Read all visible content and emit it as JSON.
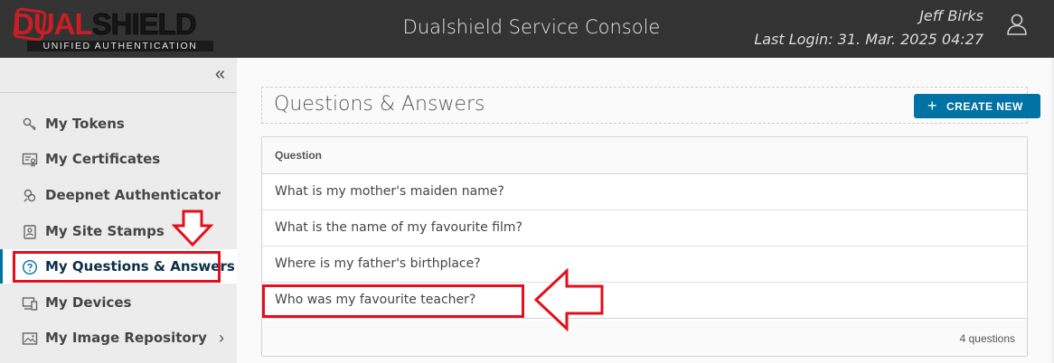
{
  "header": {
    "logo_text_red": "DUAL",
    "logo_text_dark": "SHIELD",
    "logo_tagline": "UNIFIED AUTHENTICATION",
    "app_title": "Dualshield Service Console",
    "user_name": "Jeff Birks",
    "last_login": "Last Login: 31. Mar. 2025 04:27",
    "user_icon": "user-icon"
  },
  "sidebar": {
    "collapse_icon": "double-chevron-left-icon",
    "collapse_glyph": "«",
    "items": [
      {
        "label": "My Tokens",
        "icon": "key-icon"
      },
      {
        "label": "My Certificates",
        "icon": "certificate-icon"
      },
      {
        "label": "Deepnet Authenticator",
        "icon": "authenticator-icon"
      },
      {
        "label": "My Site Stamps",
        "icon": "site-stamp-icon"
      },
      {
        "label": "My Questions & Answers",
        "icon": "question-circle-icon",
        "active": true
      },
      {
        "label": "My Devices",
        "icon": "devices-icon"
      },
      {
        "label": "My Image Repository",
        "icon": "image-icon",
        "expand_glyph": "›"
      }
    ]
  },
  "main": {
    "page_title": "Questions & Answers",
    "create_button": {
      "plus": "+",
      "label": "CREATE NEW"
    },
    "grid": {
      "column_header": "Question",
      "rows": [
        "What is my mother's maiden name?",
        "What is the name of my favourite film?",
        "Where is my father's birthplace?",
        "Who was my favourite teacher?"
      ],
      "footer": "4 questions"
    }
  },
  "colors": {
    "header_bg": "#333333",
    "accent": "#0072a3",
    "annotation_red": "#e2101c",
    "brand_red": "#c81e24"
  }
}
